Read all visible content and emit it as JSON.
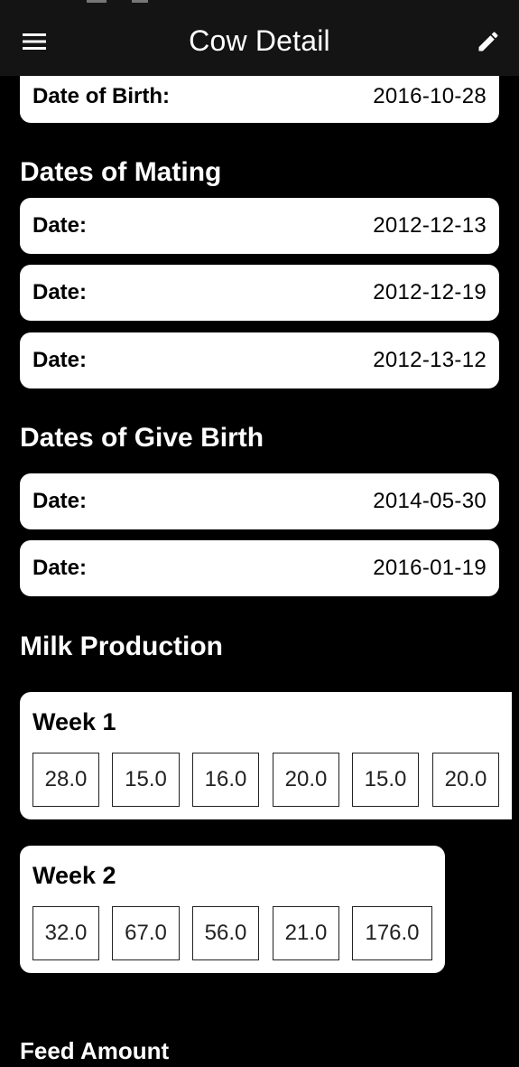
{
  "app_bar": {
    "title": "Cow Detail",
    "menu_icon": "menu-icon",
    "edit_icon": "edit-pencil-icon"
  },
  "birth": {
    "label": "Date of Birth:",
    "value": "2016-10-28"
  },
  "mating": {
    "title": "Dates of Mating",
    "items": [
      {
        "label": "Date:",
        "value": "2012-12-13"
      },
      {
        "label": "Date:",
        "value": "2012-12-19"
      },
      {
        "label": "Date:",
        "value": "2012-13-12"
      }
    ]
  },
  "give_birth": {
    "title": "Dates of Give Birth",
    "items": [
      {
        "label": "Date:",
        "value": "2014-05-30"
      },
      {
        "label": "Date:",
        "value": "2016-01-19"
      }
    ]
  },
  "milk": {
    "title": "Milk Production",
    "weeks": [
      {
        "title": "Week 1",
        "values": [
          "28.0",
          "15.0",
          "16.0",
          "20.0",
          "15.0",
          "20.0"
        ]
      },
      {
        "title": "Week 2",
        "values": [
          "32.0",
          "67.0",
          "56.0",
          "21.0",
          "176.0"
        ]
      }
    ]
  },
  "feed": {
    "title": "Feed Amount"
  },
  "colors": {
    "background": "#000000",
    "app_bar": "#141414",
    "card": "#ffffff"
  }
}
